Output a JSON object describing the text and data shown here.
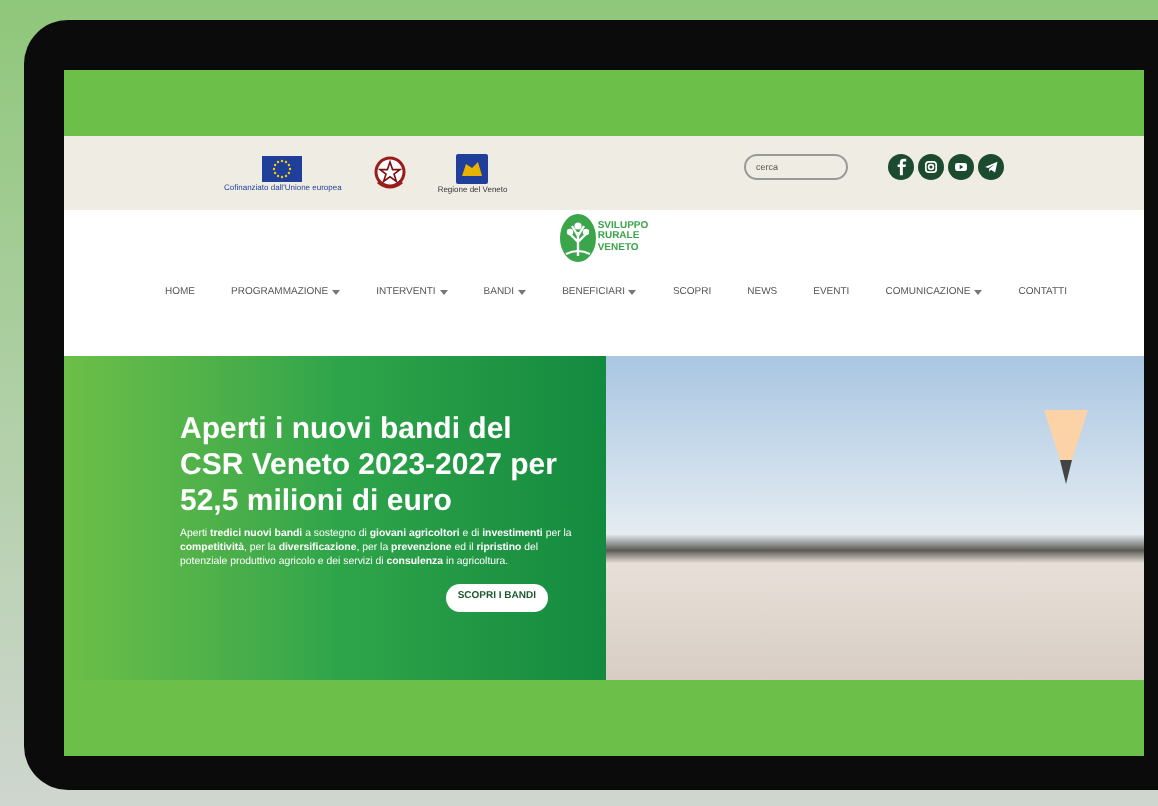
{
  "topbar": {
    "logos": [
      {
        "kind": "eu",
        "caption": "Cofinanziato dall'Unione europea"
      },
      {
        "kind": "emblem"
      },
      {
        "kind": "region",
        "caption": "Regione del Veneto"
      }
    ],
    "search": {
      "placeholder": "cerca"
    },
    "social": [
      {
        "kind": "facebook"
      },
      {
        "kind": "instagram"
      },
      {
        "kind": "youtube"
      },
      {
        "kind": "telegram"
      }
    ]
  },
  "brand": {
    "lines": [
      "SVILUPPO",
      "RURALE",
      "VENETO"
    ]
  },
  "nav": [
    {
      "label": "HOME",
      "dropdown": false
    },
    {
      "label": "PROGRAMMAZIONE",
      "dropdown": true
    },
    {
      "label": "INTERVENTI",
      "dropdown": true
    },
    {
      "label": "BANDI",
      "dropdown": true
    },
    {
      "label": "BENEFICIARI",
      "dropdown": true
    },
    {
      "label": "SCOPRI",
      "dropdown": false
    },
    {
      "label": "NEWS",
      "dropdown": false
    },
    {
      "label": "EVENTI",
      "dropdown": false
    },
    {
      "label": "COMUNICAZIONE",
      "dropdown": true
    },
    {
      "label": "CONTATTI",
      "dropdown": false
    }
  ],
  "hero": {
    "title": "Aperti i nuovi bandi del CSR Veneto 2023-2027 per 52,5 milioni di euro",
    "text": "Aperti **tredici nuovi bandi** a sostegno di **giovani agricoltori** e di **investimenti** per la **competitività**, per la **diversificazione**, per la **prevenzione** ed il **ripristino** del potenziale produttivo agricolo e dei servizi di **consulenza** in agricoltura.",
    "button": "SCOPRI I BANDI"
  }
}
